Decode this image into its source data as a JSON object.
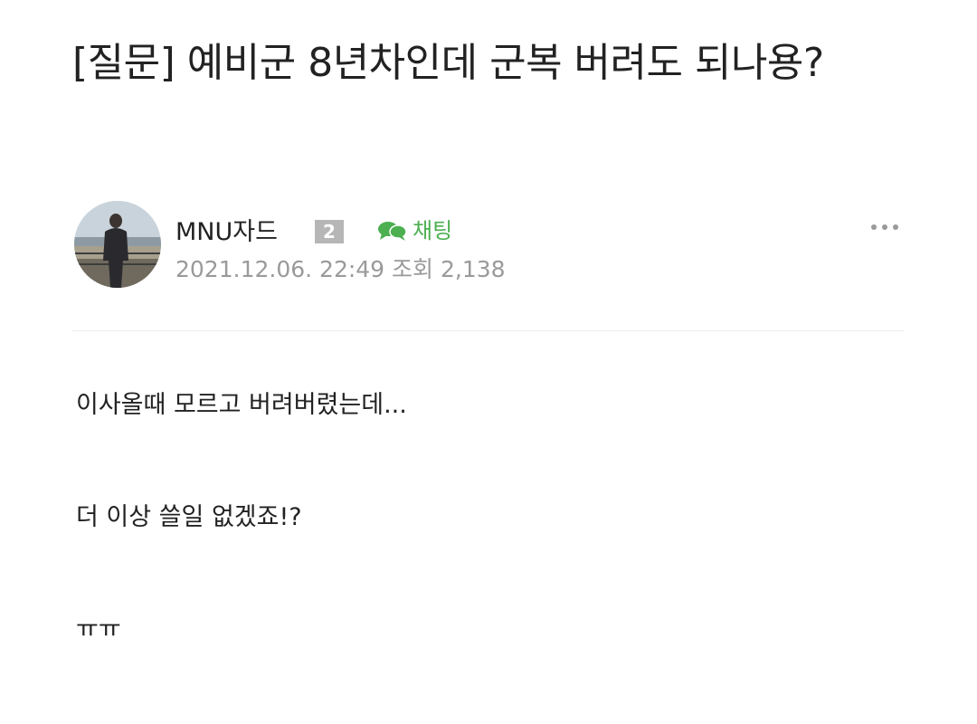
{
  "post": {
    "title": "[질문] 예비군 8년차인데 군복 버려도 되나용?",
    "author": {
      "name": "MNU자드",
      "level": "2",
      "avatar_icon": "profile-photo"
    },
    "chat": {
      "icon": "chat-bubble-icon",
      "label": "채팅",
      "color": "#4caf50"
    },
    "meta": {
      "datetime": "2021.12.06. 22:49",
      "views_label": "조회",
      "views_count": "2,138"
    },
    "more_icon": "more-options-icon",
    "body": [
      "이사올때 모르고 버려버렸는데...",
      "더 이상 쓸일 없겠죠!?",
      "ㅠㅠ"
    ]
  }
}
